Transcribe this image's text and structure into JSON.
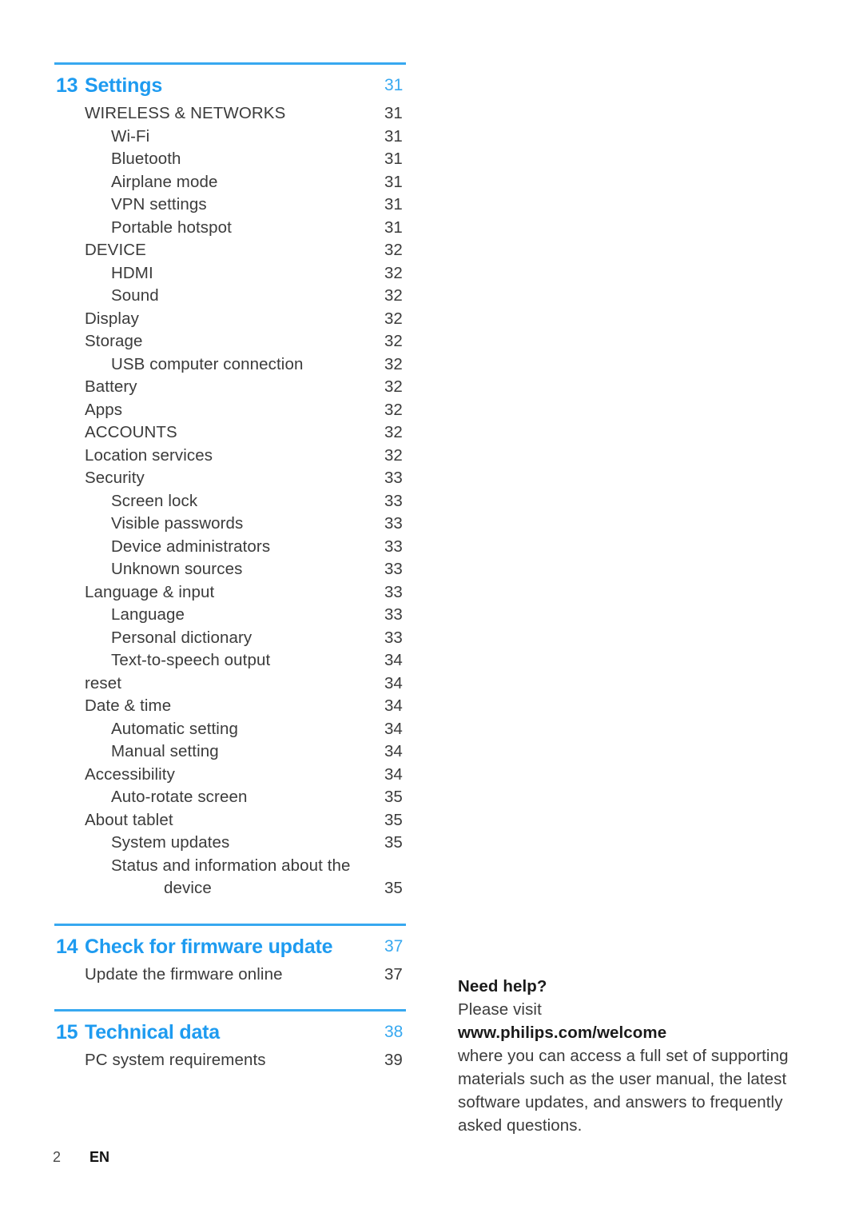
{
  "document": {
    "footer": {
      "page_number": "2",
      "language": "EN"
    }
  },
  "toc": {
    "chapters": [
      {
        "number": "13",
        "title": "Settings",
        "page": "31",
        "entries": [
          {
            "label": "WIRELESS & NETWORKS",
            "page": "31",
            "level": 1
          },
          {
            "label": "Wi-Fi",
            "page": "31",
            "level": 2
          },
          {
            "label": "Bluetooth",
            "page": "31",
            "level": 2
          },
          {
            "label": "Airplane mode",
            "page": "31",
            "level": 2
          },
          {
            "label": "VPN settings",
            "page": "31",
            "level": 2
          },
          {
            "label": "Portable hotspot",
            "page": "31",
            "level": 2
          },
          {
            "label": "DEVICE",
            "page": "32",
            "level": 1
          },
          {
            "label": "HDMI",
            "page": "32",
            "level": 2
          },
          {
            "label": "Sound",
            "page": "32",
            "level": 2
          },
          {
            "label": "Display",
            "page": "32",
            "level": 1
          },
          {
            "label": "Storage",
            "page": "32",
            "level": 1
          },
          {
            "label": "USB computer connection",
            "page": "32",
            "level": 2
          },
          {
            "label": "Battery",
            "page": "32",
            "level": 1
          },
          {
            "label": "Apps",
            "page": "32",
            "level": 1
          },
          {
            "label": "ACCOUNTS",
            "page": "32",
            "level": 1
          },
          {
            "label": "Location services",
            "page": "32",
            "level": 1
          },
          {
            "label": "Security",
            "page": "33",
            "level": 1
          },
          {
            "label": "Screen lock",
            "page": "33",
            "level": 2
          },
          {
            "label": "Visible passwords",
            "page": "33",
            "level": 2
          },
          {
            "label": "Device administrators",
            "page": "33",
            "level": 2
          },
          {
            "label": "Unknown sources",
            "page": "33",
            "level": 2
          },
          {
            "label": "Language & input",
            "page": "33",
            "level": 1
          },
          {
            "label": "Language",
            "page": "33",
            "level": 2
          },
          {
            "label": "Personal dictionary",
            "page": "33",
            "level": 2
          },
          {
            "label": "Text-to-speech output",
            "page": "34",
            "level": 2
          },
          {
            "label": "reset",
            "page": "34",
            "level": 1
          },
          {
            "label": "Date & time",
            "page": "34",
            "level": 1
          },
          {
            "label": "Automatic setting",
            "page": "34",
            "level": 2
          },
          {
            "label": "Manual setting",
            "page": "34",
            "level": 2
          },
          {
            "label": "Accessibility",
            "page": "34",
            "level": 1
          },
          {
            "label": "Auto-rotate screen",
            "page": "35",
            "level": 2
          },
          {
            "label": "About tablet",
            "page": "35",
            "level": 1
          },
          {
            "label": "System updates",
            "page": "35",
            "level": 2
          },
          {
            "label": "Status and information about the",
            "label_line2": "device",
            "page": "35",
            "level": 2,
            "wrapped": true
          }
        ]
      },
      {
        "number": "14",
        "title": "Check for firmware update",
        "page": "37",
        "entries": [
          {
            "label": "Update the firmware online",
            "page": "37",
            "level": 1
          }
        ]
      },
      {
        "number": "15",
        "title": "Technical data",
        "page": "38",
        "entries": [
          {
            "label": "PC system requirements",
            "page": "39",
            "level": 1
          }
        ]
      }
    ]
  },
  "help": {
    "title": "Need help?",
    "please_visit": "Please visit",
    "url": "www.philips.com/welcome",
    "body": "where you can access a full set of supporting materials such as the user manual, the latest software updates, and answers to frequently asked questions."
  },
  "colors": {
    "accent_blue": "#1E9BF0",
    "rule_blue": "#37A8F0",
    "body_text": "#3b3b3b"
  }
}
